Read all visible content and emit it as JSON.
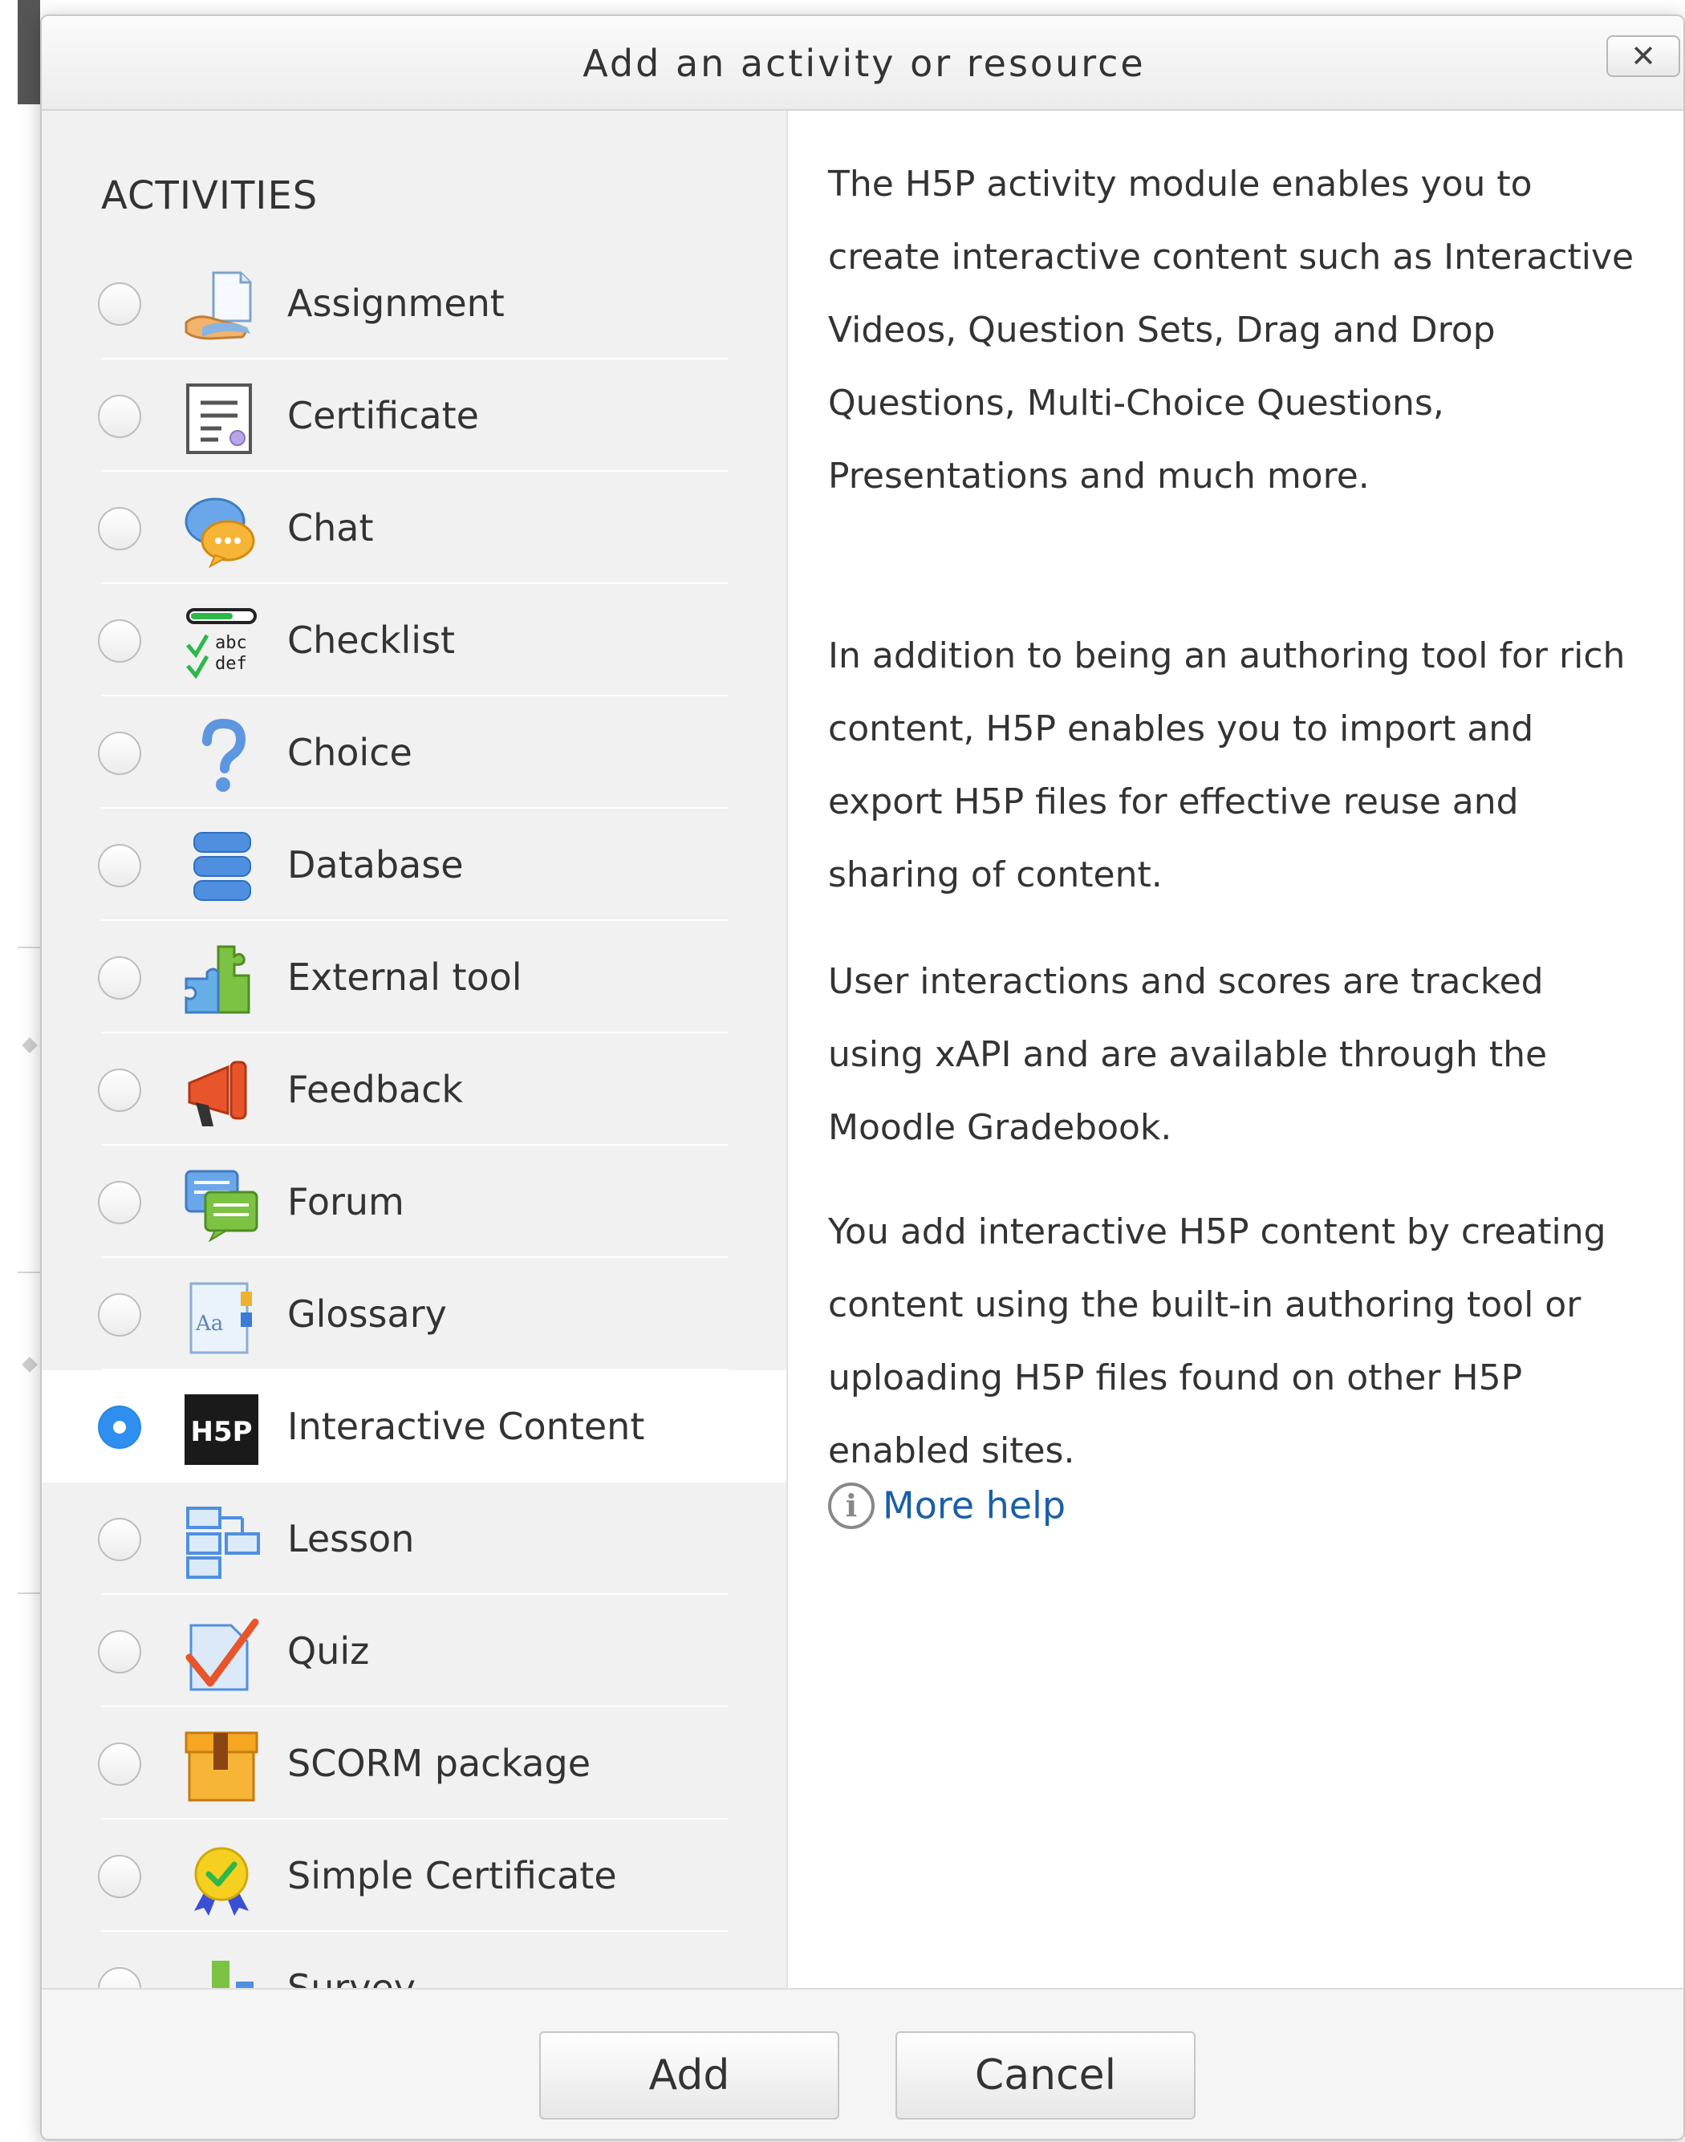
{
  "dialog": {
    "title": "Add an activity or resource",
    "close_label": "✕"
  },
  "activities": {
    "section_label": "ACTIVITIES",
    "selected": "Interactive Content",
    "items": [
      {
        "label": "Assignment",
        "icon": "assignment-icon"
      },
      {
        "label": "Certificate",
        "icon": "certificate-icon"
      },
      {
        "label": "Chat",
        "icon": "chat-icon"
      },
      {
        "label": "Checklist",
        "icon": "checklist-icon",
        "icon_text_1": "abc",
        "icon_text_2": "def"
      },
      {
        "label": "Choice",
        "icon": "choice-icon"
      },
      {
        "label": "Database",
        "icon": "database-icon"
      },
      {
        "label": "External tool",
        "icon": "external-tool-icon"
      },
      {
        "label": "Feedback",
        "icon": "feedback-icon"
      },
      {
        "label": "Forum",
        "icon": "forum-icon"
      },
      {
        "label": "Glossary",
        "icon": "glossary-icon",
        "icon_text": "Aa"
      },
      {
        "label": "Interactive Content",
        "icon": "h5p-icon",
        "icon_text": "H5P"
      },
      {
        "label": "Lesson",
        "icon": "lesson-icon"
      },
      {
        "label": "Quiz",
        "icon": "quiz-icon"
      },
      {
        "label": "SCORM package",
        "icon": "scorm-package-icon"
      },
      {
        "label": "Simple Certificate",
        "icon": "simple-certificate-icon"
      },
      {
        "label": "Survey",
        "icon": "survey-icon"
      }
    ]
  },
  "help": {
    "paragraphs": [
      "The H5P activity module enables you to create interactive content such as Interactive Videos, Question Sets, Drag and Drop Questions, Multi-Choice Questions, Presentations and much more.",
      "In addition to being an authoring tool for rich content, H5P enables you to import and export H5P files for effective reuse and sharing of content.",
      "User interactions and scores are tracked using xAPI and are available through the Moodle Gradebook.",
      "You add interactive H5P content by creating content using the built-in authoring tool or uploading H5P files found on other H5P enabled sites."
    ],
    "more_help_label": "More help",
    "info_icon": "i"
  },
  "footer": {
    "add_label": "Add",
    "cancel_label": "Cancel"
  },
  "colors": {
    "accent": "#2e8ff0",
    "link": "#1a5fa8",
    "panel_bg": "#f1f1f1"
  }
}
